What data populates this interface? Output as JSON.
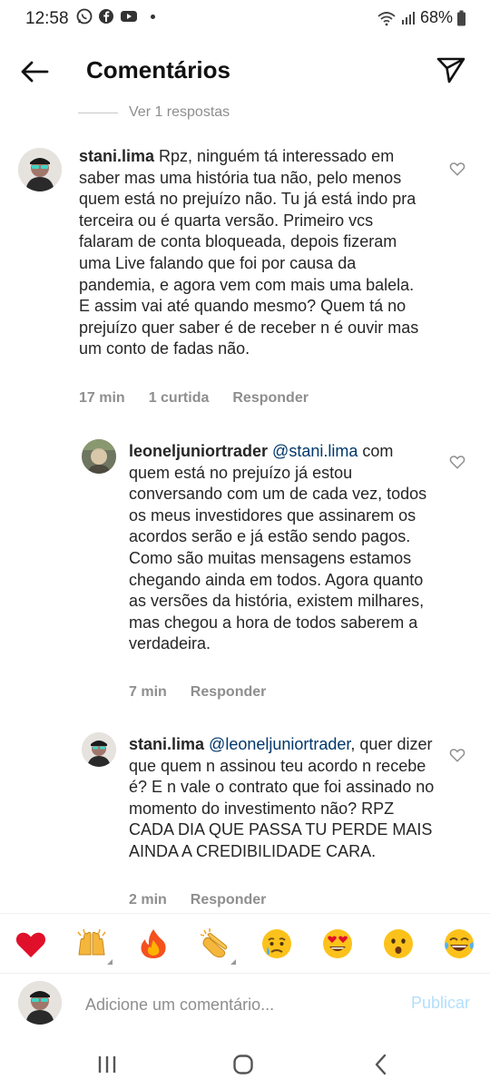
{
  "status": {
    "time": "12:58",
    "battery": "68%",
    "app_icons": [
      "whatsapp-icon",
      "facebook-icon",
      "youtube-icon"
    ]
  },
  "header": {
    "title": "Comentários"
  },
  "view_replies": "Ver 1 respostas",
  "comments": [
    {
      "username": "stani.lima",
      "mention": "",
      "text": "Rpz, ninguém tá interessado em saber mas uma história tua não, pelo menos quem está no prejuízo não. Tu já está indo pra terceira ou é quarta versão. Primeiro vcs falaram de conta bloqueada, depois fizeram uma Live falando que foi por causa da pandemia, e agora vem com mais uma balela. E assim vai até quando mesmo? Quem tá no prejuízo quer saber é de receber n é ouvir mas um conto de fadas não.",
      "time": "17 min",
      "likes": "1 curtida",
      "reply_label": "Responder"
    },
    {
      "username": "leoneljuniortrader",
      "mention": "@stani.lima",
      "text": "com quem está no prejuízo já estou conversando com um de cada vez, todos os meus investidores que assinarem os acordos serão e já estão sendo pagos. Como são muitas mensagens estamos chegando ainda em todos. Agora quanto as versões da história, existem milhares, mas chegou a hora de todos saberem a verdadeira.",
      "time": "7 min",
      "likes": "",
      "reply_label": "Responder"
    },
    {
      "username": "stani.lima",
      "mention": "@leoneljuniortrader",
      "text": ", quer dizer que quem n assinou teu acordo n recebe é? E n vale o contrato que  foi assinado no momento do investimento não? RPZ CADA DIA QUE PASSA TU PERDE MAIS AINDA A CREDIBILIDADE CARA.",
      "time": "2 min",
      "likes": "",
      "reply_label": "Responder"
    }
  ],
  "emoji_bar": [
    "❤️",
    "🙌",
    "🔥",
    "👏",
    "😢",
    "😍",
    "😮",
    "😂"
  ],
  "compose": {
    "placeholder": "Adicione um comentário...",
    "publish_label": "Publicar"
  },
  "colors": {
    "text": "#262626",
    "muted": "#8e8e8e",
    "mention": "#00376b",
    "publish_disabled": "#b2dffc"
  }
}
